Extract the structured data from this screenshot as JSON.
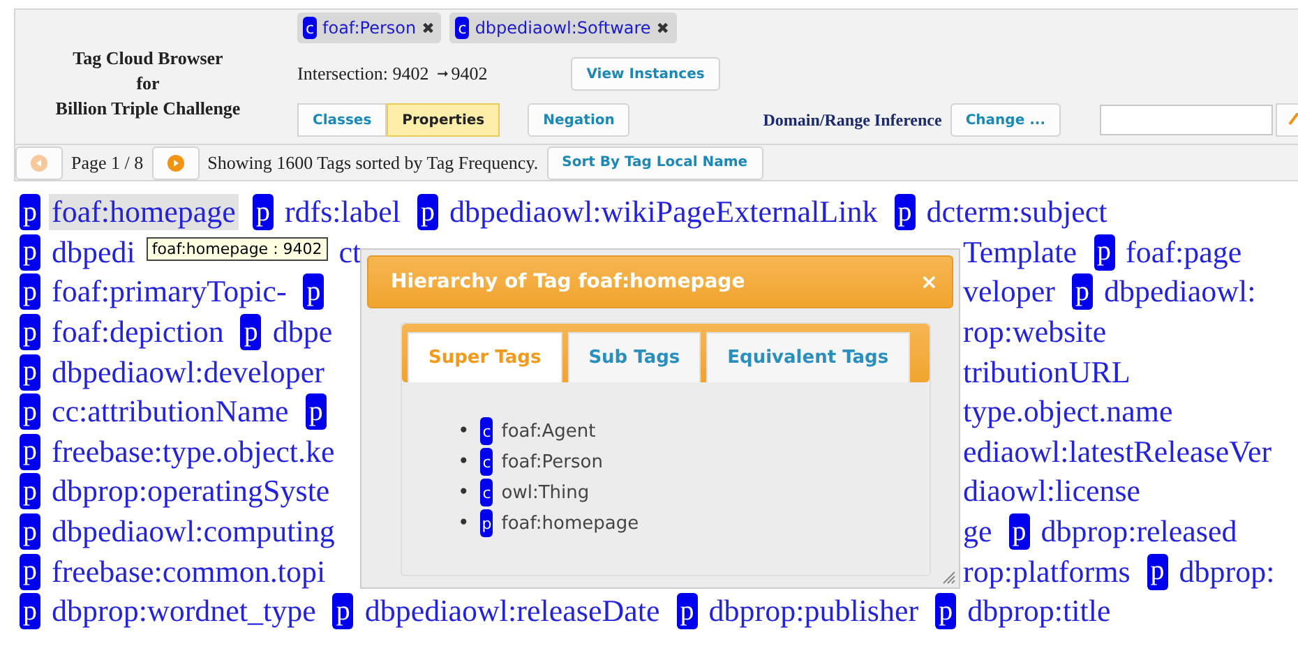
{
  "header": {
    "title_lines": [
      "Tag Cloud Browser",
      "for",
      "Billion Triple Challenge"
    ],
    "chips": [
      {
        "badge": "c",
        "label": "foaf:Person",
        "remove": "✖"
      },
      {
        "badge": "c",
        "label": "dbpediaowl:Software",
        "remove": "✖"
      }
    ],
    "intersection": {
      "label": "Intersection: 9402",
      "arrow": "➞",
      "value": "9402"
    },
    "view_button": "View Instances",
    "mode_tabs": [
      {
        "label": "Classes",
        "selected": false
      },
      {
        "label": "Properties",
        "selected": true
      }
    ],
    "negation_button": "Negation",
    "inference_label": "Domain/Range Inference",
    "change_button": "Change ..."
  },
  "pager": {
    "prev": {
      "disabled": true
    },
    "page": "Page 1 / 8",
    "next": {
      "disabled": false
    },
    "summary": "Showing 1600 Tags sorted by Tag Frequency.",
    "sort_button": "Sort By Tag Local Name"
  },
  "cloud": {
    "rows": [
      {
        "kind": "full",
        "left": [
          {
            "kind": "tag",
            "badge": "p",
            "text": "foaf:homepage",
            "hovered": true
          },
          {
            "kind": "tag",
            "badge": "p",
            "text": "rdfs:label",
            "hovered": false
          },
          {
            "kind": "tag",
            "badge": "p",
            "text": "dbpediaowl:wikiPageExternalLink",
            "hovered": false
          },
          {
            "kind": "tag",
            "badge": "p",
            "text": "dcterm:subject",
            "hovered": false
          }
        ]
      },
      {
        "kind": "split",
        "left": [
          {
            "kind": "tag",
            "badge": "p",
            "text": "dbpedi",
            "hovered": false
          },
          {
            "kind": "tooltip",
            "text": "foaf:homepage : 9402"
          },
          {
            "kind": "tag",
            "text": "ct",
            "hovered": false
          }
        ],
        "right": [
          {
            "kind": "tag",
            "text": "Template",
            "hovered": false
          },
          {
            "kind": "tag",
            "badge": "p",
            "text": "foaf:page",
            "hovered": false
          }
        ]
      },
      {
        "kind": "split",
        "left": [
          {
            "kind": "tag",
            "badge": "p",
            "text": "foaf:primaryTopic-",
            "hovered": false
          },
          {
            "kind": "tag",
            "badge": "p"
          }
        ],
        "right": [
          {
            "kind": "tag",
            "text": "veloper",
            "hovered": false
          },
          {
            "kind": "tag",
            "badge": "p",
            "text": "dbpediaowl:",
            "hovered": false
          }
        ]
      },
      {
        "kind": "split",
        "left": [
          {
            "kind": "tag",
            "badge": "p",
            "text": "foaf:depiction",
            "hovered": false
          },
          {
            "kind": "tag",
            "badge": "p",
            "text": "dbpe",
            "hovered": false
          }
        ],
        "right": [
          {
            "kind": "tag",
            "text": "rop:website",
            "hovered": false
          }
        ]
      },
      {
        "kind": "split",
        "left": [
          {
            "kind": "tag",
            "badge": "p",
            "text": "dbpediaowl:developer",
            "hovered": false
          }
        ],
        "right": [
          {
            "kind": "tag",
            "text": "tributionURL",
            "hovered": false
          }
        ]
      },
      {
        "kind": "split",
        "left": [
          {
            "kind": "tag",
            "badge": "p",
            "text": "cc:attributionName",
            "hovered": false
          },
          {
            "kind": "tag",
            "badge": "p"
          }
        ],
        "right": [
          {
            "kind": "tag",
            "text": "type.object.name",
            "hovered": false
          }
        ]
      },
      {
        "kind": "split",
        "left": [
          {
            "kind": "tag",
            "badge": "p",
            "text": "freebase:type.object.ke",
            "hovered": false
          }
        ],
        "right": [
          {
            "kind": "tag",
            "text": "ediaowl:latestReleaseVer",
            "hovered": false
          }
        ]
      },
      {
        "kind": "split",
        "left": [
          {
            "kind": "tag",
            "badge": "p",
            "text": "dbprop:operatingSyste",
            "hovered": false
          }
        ],
        "right": [
          {
            "kind": "tag",
            "text": "diaowl:license",
            "hovered": false
          }
        ]
      },
      {
        "kind": "split",
        "left": [
          {
            "kind": "tag",
            "badge": "p",
            "text": "dbpediaowl:computing",
            "hovered": false
          }
        ],
        "right": [
          {
            "kind": "tag",
            "text": "ge",
            "hovered": false
          },
          {
            "kind": "tag",
            "badge": "p",
            "text": "dbprop:released",
            "hovered": false
          }
        ]
      },
      {
        "kind": "split",
        "left": [
          {
            "kind": "tag",
            "badge": "p",
            "text": "freebase:common.topi",
            "hovered": false
          }
        ],
        "right": [
          {
            "kind": "tag",
            "text": "rop:platforms",
            "hovered": false
          },
          {
            "kind": "tag",
            "badge": "p",
            "text": "dbprop:",
            "hovered": false
          }
        ]
      },
      {
        "kind": "full",
        "left": [
          {
            "kind": "tag",
            "badge": "p",
            "text": "dbprop:wordnet_type",
            "hovered": false
          },
          {
            "kind": "tag",
            "badge": "p",
            "text": "dbpediaowl:releaseDate",
            "hovered": false
          },
          {
            "kind": "tag",
            "badge": "p",
            "text": "dbprop:publisher",
            "hovered": false
          },
          {
            "kind": "tag",
            "badge": "p",
            "text": "dbprop:title",
            "hovered": false
          }
        ]
      }
    ]
  },
  "dialog": {
    "title": "Hierarchy of Tag foaf:homepage",
    "close": "×",
    "tabs": [
      {
        "label": "Super Tags",
        "selected": true
      },
      {
        "label": "Sub Tags",
        "selected": false
      },
      {
        "label": "Equivalent Tags",
        "selected": false
      }
    ],
    "items": [
      {
        "marker": "•",
        "badge": "c",
        "text": "foaf:Agent"
      },
      {
        "marker": "•",
        "badge": "c",
        "text": "foaf:Person"
      },
      {
        "marker": "•",
        "badge": "c",
        "text": "owl:Thing"
      },
      {
        "marker": "•",
        "badge": "p",
        "text": "foaf:homepage"
      }
    ]
  }
}
